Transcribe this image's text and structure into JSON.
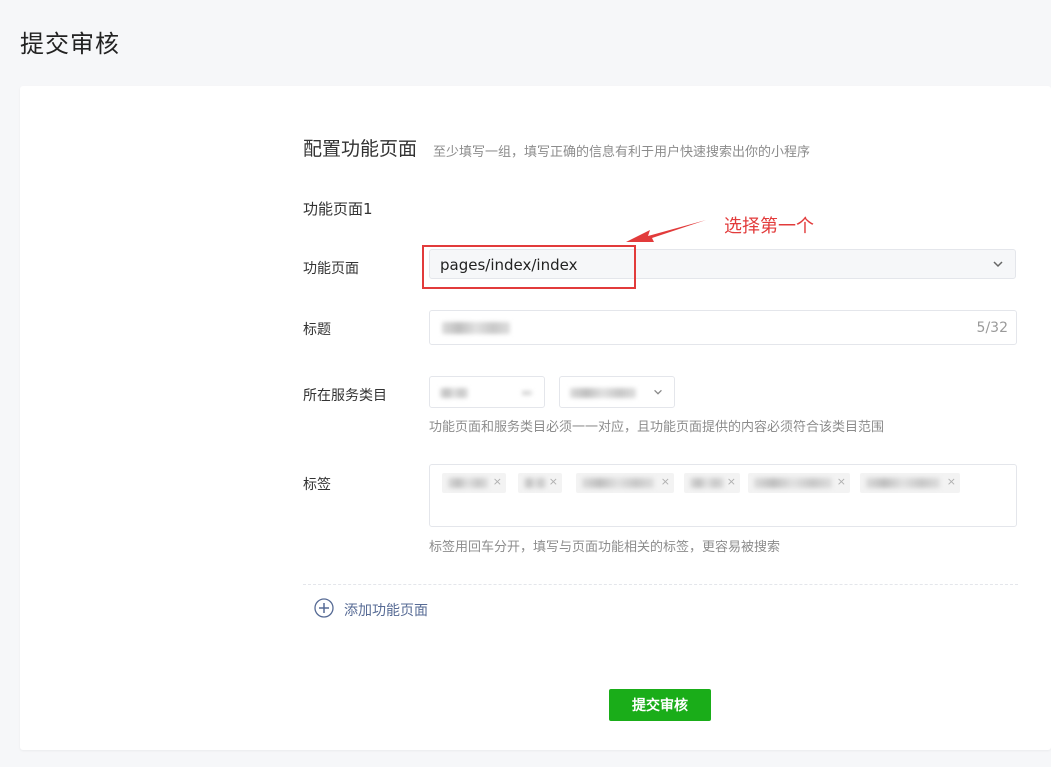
{
  "page": {
    "title": "提交审核"
  },
  "section": {
    "title": "配置功能页面",
    "hint": "至少填写一组，填写正确的信息有利于用户快速搜索出你的小程序"
  },
  "group": {
    "title": "功能页面1",
    "page_label": "功能页面",
    "page_value": "pages/index/index",
    "title_label": "标题",
    "title_counter": "5/32",
    "category_label": "所在服务类目",
    "category_hint": "功能页面和服务类目必须一一对应，且功能页面提供的内容必须符合该类目范围",
    "tags_label": "标签",
    "tags_hint": "标签用回车分开，填写与页面功能相关的标签，更容易被搜索",
    "tags_x": "×"
  },
  "annotation": {
    "text": "选择第一个",
    "color": "#e23b3b"
  },
  "actions": {
    "add_page_label": "添加功能页面",
    "submit_label": "提交审核"
  },
  "colors": {
    "primary_green": "#1aad19",
    "link_blue": "#576b95",
    "annotation_red": "#e23b3b"
  },
  "icons": {
    "select_chevron": "chevron-down-icon",
    "add": "plus-circle-icon",
    "annotation": "arrow-icon"
  }
}
